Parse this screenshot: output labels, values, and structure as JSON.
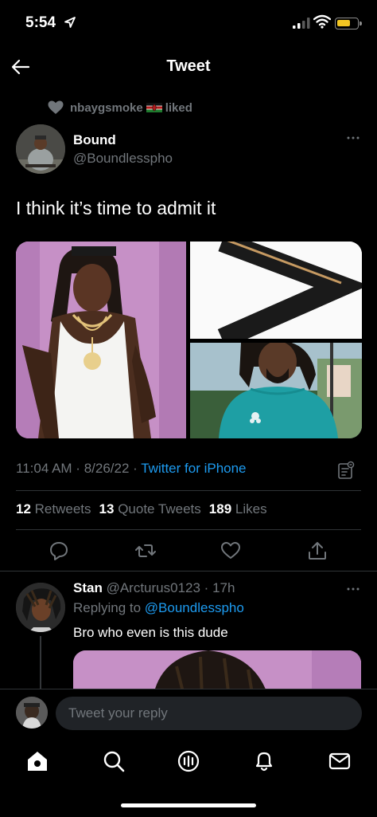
{
  "status": {
    "time": "5:54"
  },
  "nav": {
    "title": "Tweet"
  },
  "social_context": {
    "user": "nbaygsmoke",
    "action": "liked"
  },
  "tweet": {
    "author_name": "Bound",
    "author_handle": "@Boundlesspho",
    "text": "I think it’s time to admit it",
    "time": "11:04 AM",
    "date": "8/26/22",
    "source": "Twitter for iPhone",
    "separator": " · ",
    "stats": [
      {
        "count": "12",
        "label": "Retweets"
      },
      {
        "count": "13",
        "label": "Quote Tweets"
      },
      {
        "count": "189",
        "label": "Likes"
      }
    ]
  },
  "reply": {
    "name": "Stan",
    "handle": "@Arcturus0123",
    "time": "17h",
    "replying_prefix": "Replying to",
    "replying_to": "@Boundlesspho",
    "text": "Bro who even is this dude"
  },
  "compose": {
    "placeholder": "Tweet your reply"
  },
  "tabs": [
    "home-icon",
    "search-icon",
    "spaces-icon",
    "notifications-icon",
    "messages-icon"
  ],
  "colors": {
    "accent": "#1d9bf0",
    "muted": "#71767b",
    "background": "#000000"
  }
}
